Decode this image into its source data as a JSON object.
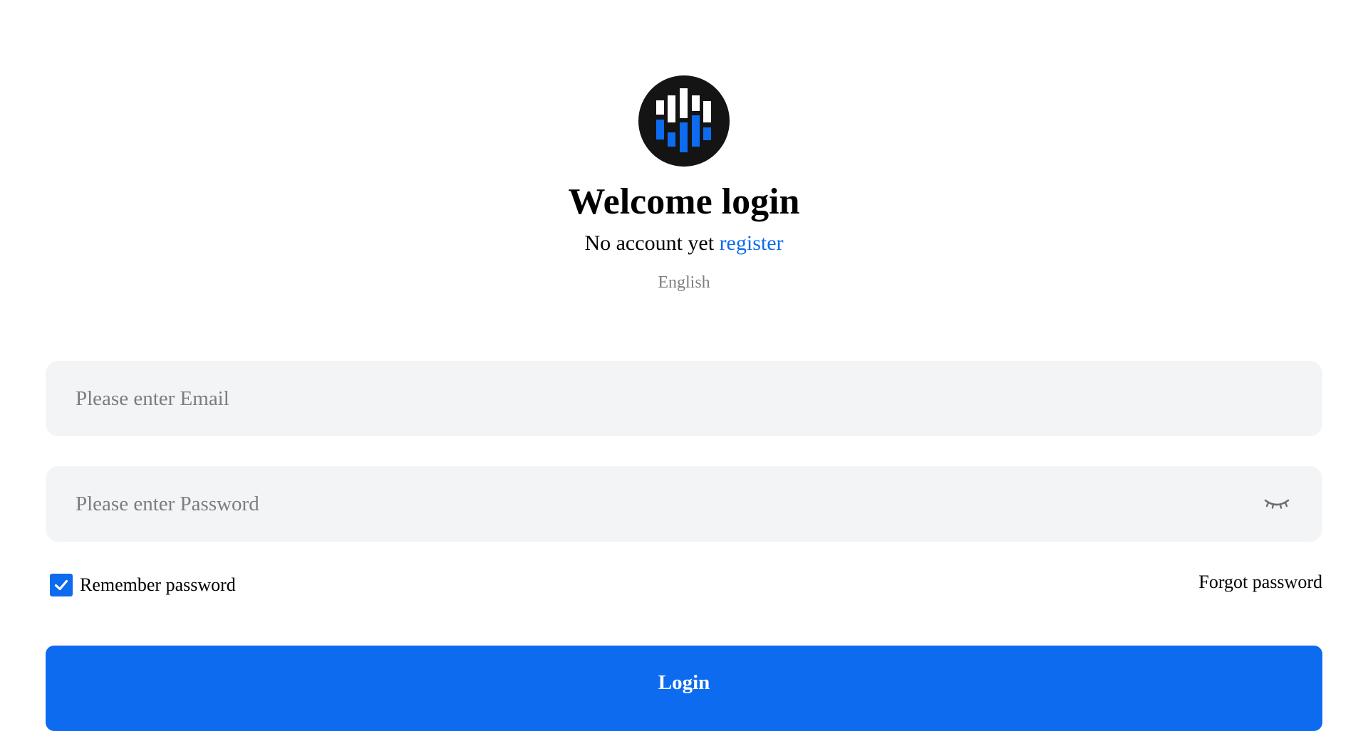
{
  "header": {
    "logo_icon": "bar-chart-logo-icon",
    "title": "Welcome login",
    "no_account_text": "No account yet ",
    "register_glyph": "",
    "register_link": "register",
    "language": "English"
  },
  "form": {
    "email_placeholder": "Please enter Email",
    "email_value": "",
    "password_placeholder": "Please enter Password",
    "password_value": "",
    "password_toggle_icon": "eye-closed-icon",
    "remember_label": "Remember password",
    "remember_checked": true,
    "forgot_label": "Forgot password",
    "login_label": "Login"
  },
  "colors": {
    "accent": "#0d6bf0",
    "logo_bg": "#141414",
    "field_bg": "#f3f4f6",
    "muted_text": "#7f7f7f"
  }
}
